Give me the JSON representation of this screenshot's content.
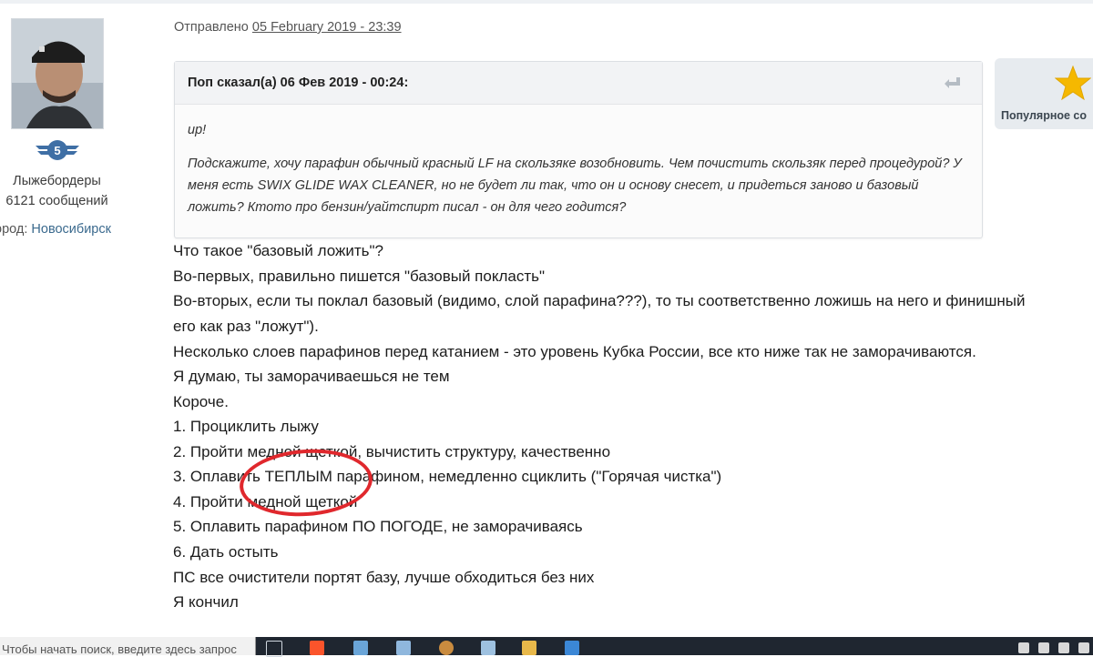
{
  "author": {
    "rank_number": "5",
    "group": "Лыжебордеры",
    "posts": "6121 сообщений",
    "city_label": "ород:",
    "city_value": "Новосибирск"
  },
  "post": {
    "sent_label": "Отправлено",
    "sent_date": "05 February 2019 - 23:39"
  },
  "quote": {
    "author_line": "Поп сказал(а) 06 Фев 2019 - 00:24:",
    "paragraphs": [
      "up!",
      "Подскажите, хочу парафин обычный красный LF на скользяке возобновить. Чем почистить скользяк перед процедурой? У меня есть SWIX GLIDE WAX CLEANER, но не будет ли так, что он и основу снесет, и придеться заново и базовый ложить? Ктото про бензин/уайтспирт писал - он для чего годится?"
    ]
  },
  "popular": {
    "label": "Популярное со"
  },
  "message": {
    "lines": [
      "Что такое \"базовый ложить\"?",
      "Во-первых, правильно пишется \"базовый покласть\"",
      "Во-вторых, если ты поклал базовый (видимо, слой парафина???), то ты соответственно ложишь на него и финишный",
      "его как раз \"ложут\").",
      "Несколько слоев парафинов перед катанием - это уровень Кубка России, все кто ниже так не заморачиваются.",
      "Я думаю, ты заморачиваешься не тем",
      "Короче.",
      "1. Проциклить лыжу",
      "2. Пройти медной щеткой, вычистить структуру, качественно",
      "3. Оплавить ТЕПЛЫМ парафином, немедленно сциклить (\"Горячая чистка\")",
      "4. Пройти медной щеткой",
      "5. Оплавить парафином ПО ПОГОДЕ, не заморачиваясь",
      "6. Дать остыть",
      "ПС все очистители портят базу, лучше обходиться без них",
      " Я кончил"
    ]
  },
  "taskbar": {
    "search_placeholder": "Чтобы начать поиск, введите здесь запрос"
  },
  "colors": {
    "link": "#3b6a8e",
    "annotation": "#e0282d",
    "rank_badge": "#3f6fa5",
    "star": "#f5b800"
  }
}
